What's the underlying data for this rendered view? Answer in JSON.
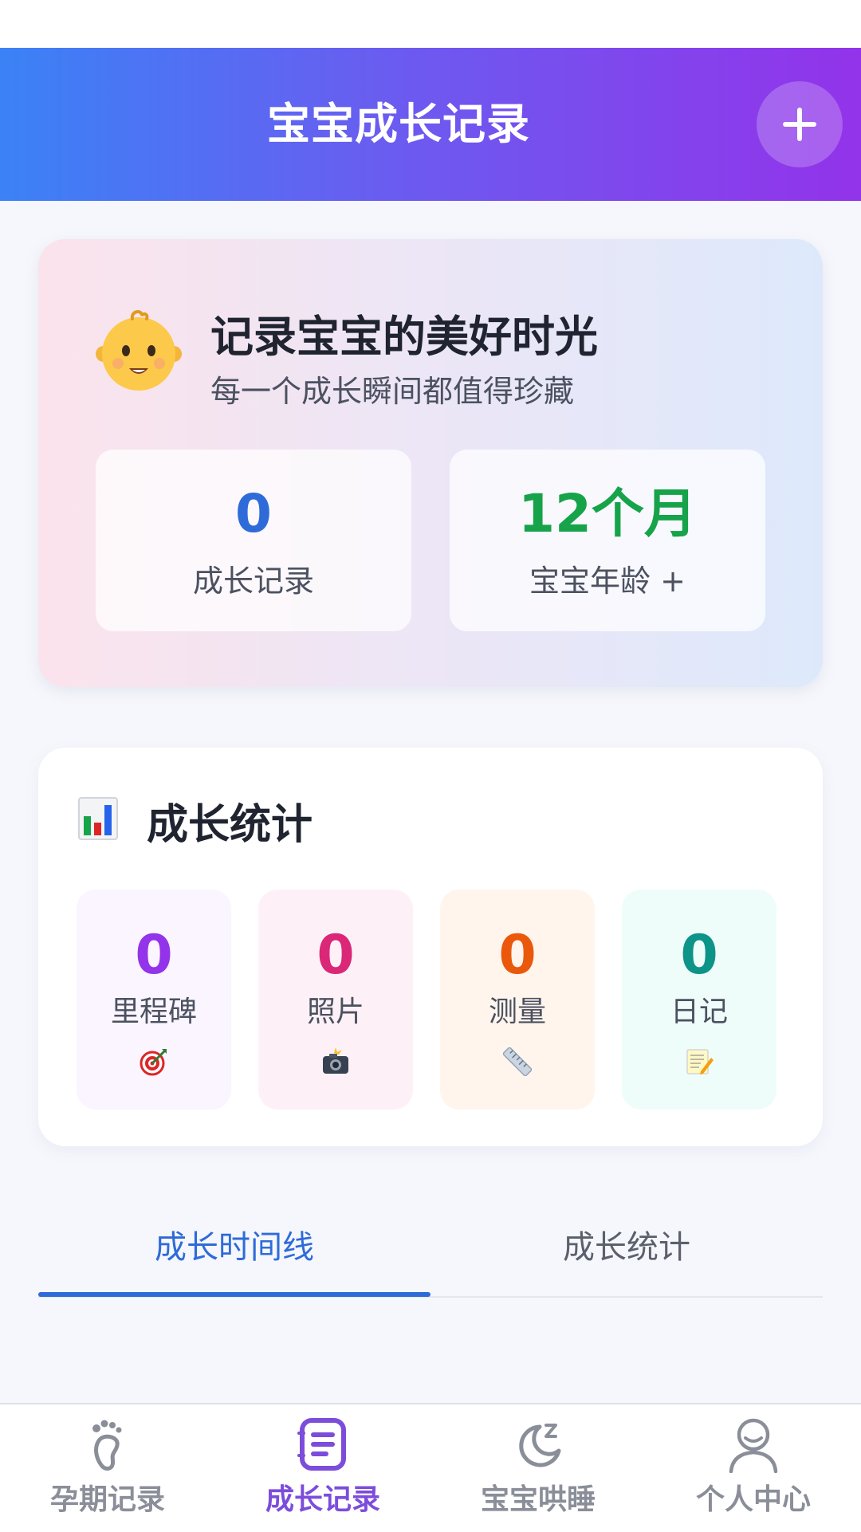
{
  "header": {
    "title": "宝宝成长记录",
    "add_icon": "plus-icon"
  },
  "hero": {
    "icon": "baby-face-icon",
    "title": "记录宝宝的美好时光",
    "subtitle": "每一个成长瞬间都值得珍藏",
    "records": {
      "value": "0",
      "label": "成长记录",
      "color": "#2f6bd8"
    },
    "age": {
      "value": "12个月",
      "label": "宝宝年龄 +",
      "color": "#16a34a"
    }
  },
  "stats": {
    "icon": "bar-chart-icon",
    "title": "成长统计",
    "items": [
      {
        "value": "0",
        "label": "里程碑",
        "icon": "target-icon",
        "color": "#9333ea",
        "bg": "#faf5fe"
      },
      {
        "value": "0",
        "label": "照片",
        "icon": "camera-flash-icon",
        "color": "#db2777",
        "bg": "#fdf1f7"
      },
      {
        "value": "0",
        "label": "测量",
        "icon": "ruler-icon",
        "color": "#ea580c",
        "bg": "#fff5ec"
      },
      {
        "value": "0",
        "label": "日记",
        "icon": "memo-icon",
        "color": "#0d9488",
        "bg": "#effdfa"
      }
    ]
  },
  "tabs": [
    {
      "label": "成长时间线",
      "active": true
    },
    {
      "label": "成长统计",
      "active": false
    }
  ],
  "bottom_nav": [
    {
      "label": "孕期记录",
      "icon": "footprint-icon",
      "active": false
    },
    {
      "label": "成长记录",
      "icon": "document-list-icon",
      "active": true
    },
    {
      "label": "宝宝哄睡",
      "icon": "moon-sleep-icon",
      "active": false
    },
    {
      "label": "个人中心",
      "icon": "user-icon",
      "active": false
    }
  ],
  "colors": {
    "header_gradient_start": "#3b82f6",
    "header_gradient_end": "#9333ea",
    "active_tab": "#2f6bd8",
    "active_nav": "#7c4ddb",
    "inactive_nav": "#8a8e98"
  }
}
